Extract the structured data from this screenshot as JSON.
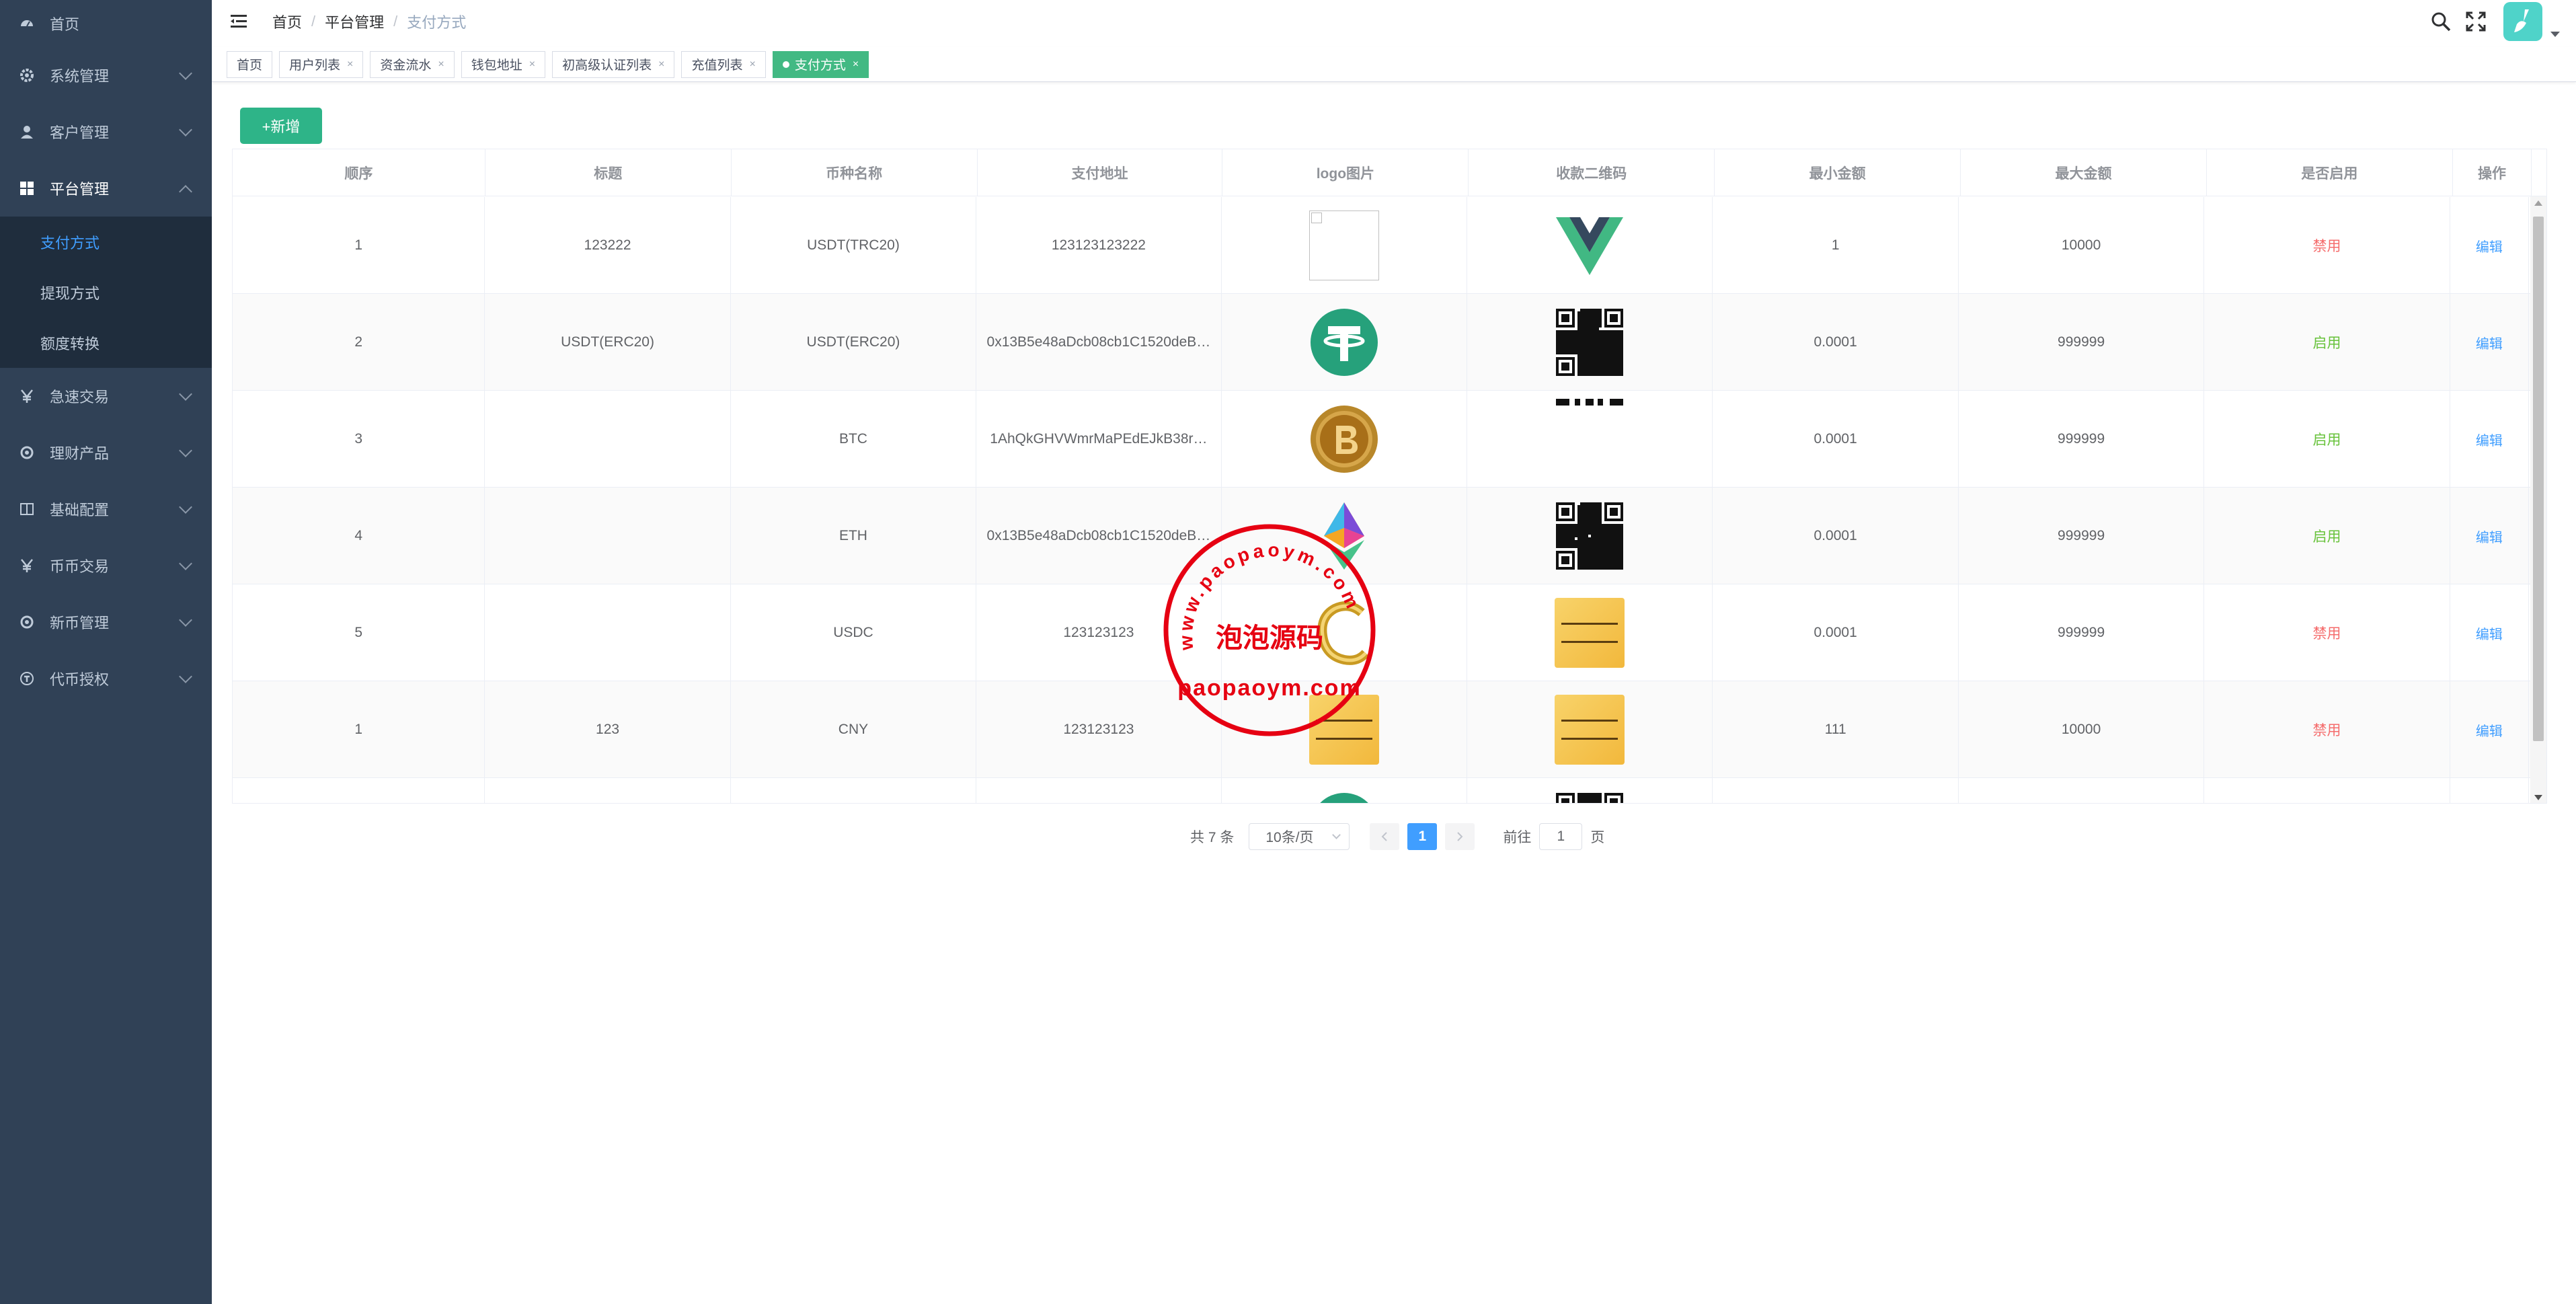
{
  "sidebar": {
    "items": [
      {
        "label": "首页",
        "icon": "dashboard-icon"
      },
      {
        "label": "系统管理",
        "icon": "gear-icon"
      },
      {
        "label": "客户管理",
        "icon": "user-icon"
      },
      {
        "label": "平台管理",
        "icon": "grid-icon"
      },
      {
        "label": "急速交易",
        "icon": "yen-icon"
      },
      {
        "label": "理财产品",
        "icon": "circle-icon"
      },
      {
        "label": "基础配置",
        "icon": "book-icon"
      },
      {
        "label": "币币交易",
        "icon": "yen-icon"
      },
      {
        "label": "新币管理",
        "icon": "circle-icon"
      },
      {
        "label": "代币授权",
        "icon": "token-icon"
      }
    ],
    "submenu": [
      {
        "label": "支付方式"
      },
      {
        "label": "提现方式"
      },
      {
        "label": "额度转换"
      }
    ]
  },
  "breadcrumb": [
    "首页",
    "平台管理",
    "支付方式"
  ],
  "crumb_sep": "/",
  "tags": [
    {
      "label": "首页"
    },
    {
      "label": "用户列表"
    },
    {
      "label": "资金流水"
    },
    {
      "label": "钱包地址"
    },
    {
      "label": "初高级认证列表"
    },
    {
      "label": "充值列表"
    },
    {
      "label": "支付方式"
    }
  ],
  "tag_close": "×",
  "toolbar": {
    "add_label": "+新增"
  },
  "table": {
    "headers": [
      "顺序",
      "标题",
      "币种名称",
      "支付地址",
      "logo图片",
      "收款二维码",
      "最小金额",
      "最大金额",
      "是否启用",
      "操作"
    ],
    "rows": [
      {
        "order": "1",
        "title": "123222",
        "coin": "USDT(TRC20)",
        "address": "123123123222",
        "logo": "broken-image",
        "qr": "vue-logo",
        "min": "1",
        "max": "10000",
        "status": "禁用",
        "status_type": "disabled",
        "action": "编辑"
      },
      {
        "order": "2",
        "title": "USDT(ERC20)",
        "coin": "USDT(ERC20)",
        "address": "0x13B5e48aDcb08cb1C1520deB…",
        "logo": "tether-logo",
        "qr": "qr-code",
        "min": "0.0001",
        "max": "999999",
        "status": "启用",
        "status_type": "enabled",
        "action": "编辑"
      },
      {
        "order": "3",
        "title": "",
        "coin": "BTC",
        "address": "1AhQkGHVWmrMaPEdEJkB38r…",
        "logo": "bitcoin-logo",
        "qr": "qr-partial",
        "min": "0.0001",
        "max": "999999",
        "status": "启用",
        "status_type": "enabled",
        "action": "编辑"
      },
      {
        "order": "4",
        "title": "",
        "coin": "ETH",
        "address": "0x13B5e48aDcb08cb1C1520deB…",
        "logo": "ethereum-logo",
        "qr": "qr-code",
        "min": "0.0001",
        "max": "999999",
        "status": "启用",
        "status_type": "enabled",
        "action": "编辑"
      },
      {
        "order": "5",
        "title": "",
        "coin": "USDC",
        "address": "123123123",
        "logo": "gold-c-logo",
        "qr": "gold-card",
        "min": "0.0001",
        "max": "999999",
        "status": "禁用",
        "status_type": "disabled",
        "action": "编辑"
      },
      {
        "order": "1",
        "title": "123",
        "coin": "CNY",
        "address": "123123123",
        "logo": "gold-card",
        "qr": "gold-card",
        "min": "111",
        "max": "10000",
        "status": "禁用",
        "status_type": "disabled",
        "action": "编辑"
      },
      {
        "order": "",
        "title": "",
        "coin": "",
        "address": "",
        "logo": "tether-logo",
        "qr": "qr-code",
        "min": "",
        "max": "",
        "status": "",
        "status_type": "",
        "action": ""
      }
    ]
  },
  "pagination": {
    "total": "共 7 条",
    "page_size": "10条/页",
    "current_page": "1",
    "goto_label": "前往",
    "goto_value": "1",
    "page_unit": "页"
  },
  "watermark": {
    "url_text": "www.paopaoym.com",
    "cn_text": "泡泡源码",
    "domain_text": "paopaoym.com",
    "color": "#e60012"
  },
  "colors": {
    "sidebar_bg": "#304156",
    "accent": "#409eff",
    "add_button": "#2eb488",
    "tag_active": "#42b983",
    "disabled": "#f56c6c",
    "enabled": "#67c23a"
  }
}
